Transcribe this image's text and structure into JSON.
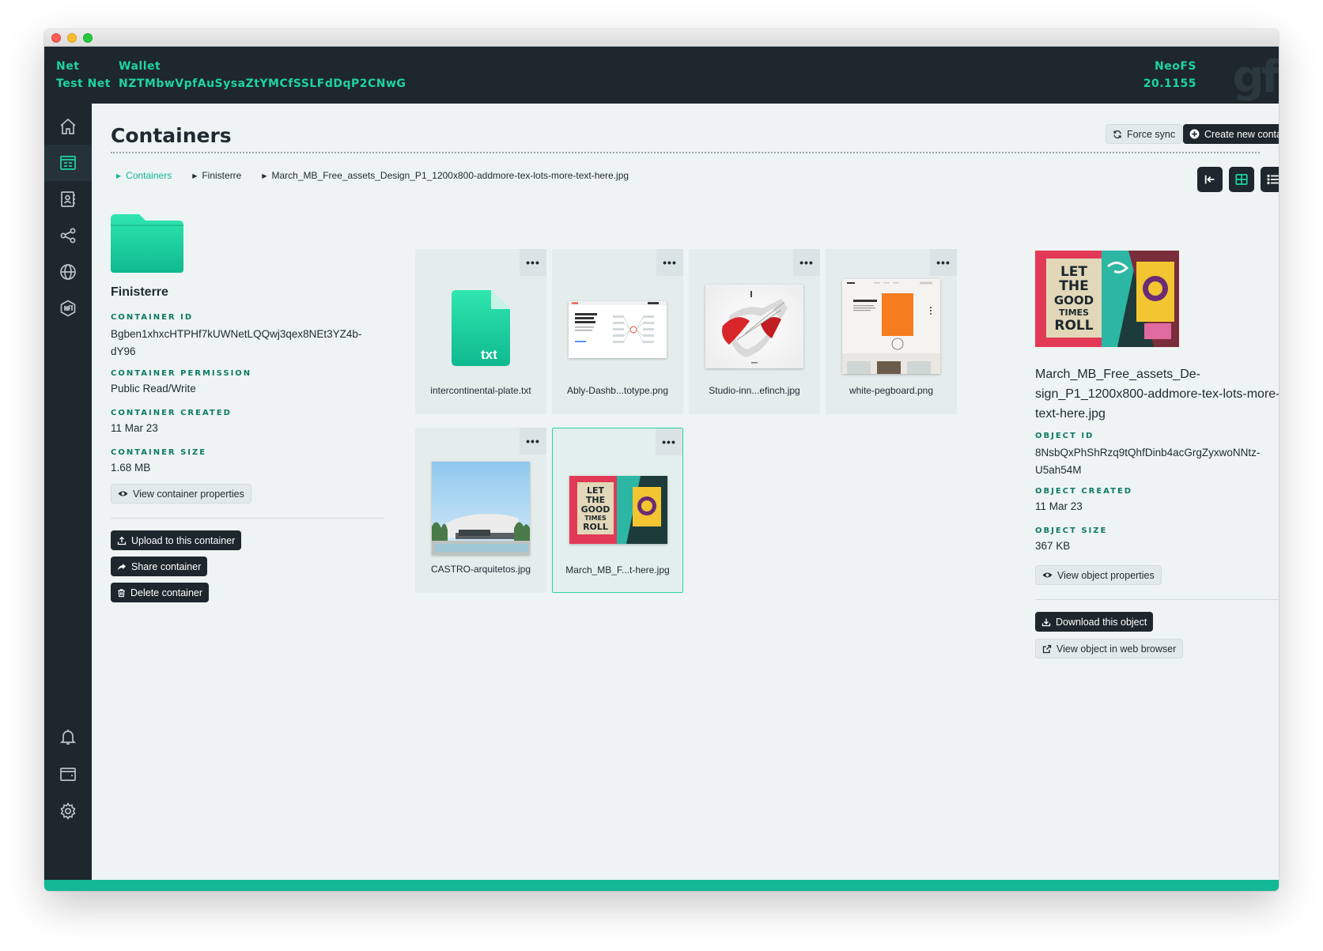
{
  "topbar": {
    "net_label": "Net",
    "net_value": "Test Net",
    "wallet_label": "Wallet",
    "wallet_value": "NZTMbwVpfAuSysaZtYMCfSSLFdDqP2CNwG",
    "neofs_label": "NeoFS",
    "neofs_value": "20.1155",
    "logo": "gf"
  },
  "sidebar": {
    "items": [
      "home-icon",
      "containers-icon",
      "contacts-icon",
      "share-icon",
      "globe-icon",
      "nft-icon",
      "bell-icon",
      "wallet-icon",
      "settings-icon"
    ],
    "active": "containers-icon"
  },
  "header": {
    "title": "Containers",
    "force_sync": "Force sync",
    "create": "Create new container"
  },
  "breadcrumb": [
    "Containers",
    "Finisterre",
    "March_MB_Free_assets_Design_P1_1200x800-addmore-tex-lots-more-text-here.jpg"
  ],
  "container": {
    "name": "Finisterre",
    "id_label": "CONTAINER ID",
    "id_line1": "Bgben1xhxcHTPHf7kUWNetLQQwj3qex8NEt3YZ4b-",
    "id_line2": "dY96",
    "permission_label": "CONTAINER PERMISSION",
    "permission": "Public Read/Write",
    "created_label": "CONTAINER CREATED",
    "created": "11 Mar 23",
    "size_label": "CONTAINER SIZE",
    "size": "1.68 MB",
    "view_props": "View container properties",
    "upload": "Upload to this container",
    "share": "Share container",
    "delete": "Delete container"
  },
  "files": [
    {
      "name": "intercontinental-plate.txt",
      "kind": "txt"
    },
    {
      "name": "Ably-Dashb...totype.png",
      "kind": "dashboard"
    },
    {
      "name": "Studio-inn...efinch.jpg",
      "kind": "sneaker"
    },
    {
      "name": "white-pegboard.png",
      "kind": "pegboard"
    },
    {
      "name": "CASTRO-arquitetos.jpg",
      "kind": "house"
    },
    {
      "name": "March_MB_F...t-here.jpg",
      "kind": "poster"
    }
  ],
  "txt_badge": "txt",
  "object": {
    "title_line1": "March_MB_Free_assets_De-",
    "title_line2": "sign_P1_1200x800-addmore-tex-lots-more-",
    "title_line3": "text-here.jpg",
    "id_label": "OBJECT ID",
    "id_line1": "8NsbQxPhShRzq9tQhfDinb4acGrgZyxwoNNtz-",
    "id_line2": "U5ah54M",
    "created_label": "OBJECT CREATED",
    "created": "11 Mar 23",
    "size_label": "OBJECT SIZE",
    "size": "367 KB",
    "view_props": "View object properties",
    "download": "Download this object",
    "open_browser": "View object in web browser"
  },
  "poster_text": [
    "LET",
    "THE",
    "GOOD",
    "TIMES",
    "ROLL"
  ],
  "colors": {
    "accent": "#13b896",
    "accent_text": "#1ed4a0",
    "dark": "#1d272d",
    "background": "#eef3f3"
  }
}
